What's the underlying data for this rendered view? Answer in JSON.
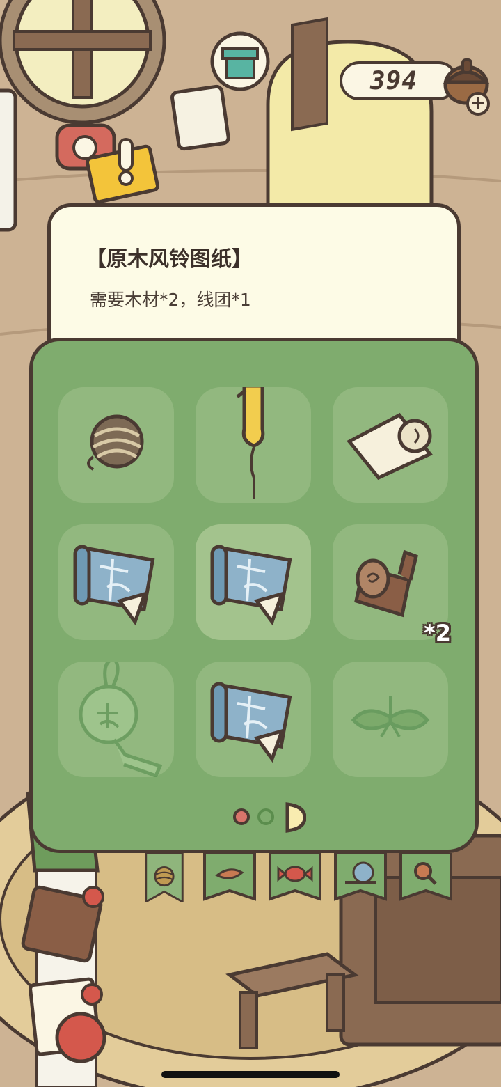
{
  "header": {
    "currency_value": "394",
    "currency_icon": "acorn-icon",
    "add_label": "+"
  },
  "tooltip": {
    "title": "【原木风铃图纸】",
    "description": "需要木材*2，线团*1"
  },
  "grid": {
    "items": [
      {
        "name": "yarn-ball",
        "icon": "yarn-ball-icon",
        "selected": false
      },
      {
        "name": "balloon",
        "icon": "balloon-icon",
        "selected": false
      },
      {
        "name": "paper-scroll",
        "icon": "paper-scroll-icon",
        "selected": false
      },
      {
        "name": "blueprint",
        "icon": "blueprint-icon",
        "selected": false
      },
      {
        "name": "blueprint",
        "icon": "blueprint-icon",
        "selected": true
      },
      {
        "name": "wood-log",
        "icon": "wood-log-icon",
        "count": "*2",
        "selected": false
      },
      {
        "name": "wind-chime",
        "icon": "wind-chime-icon",
        "selected": false
      },
      {
        "name": "blueprint",
        "icon": "blueprint-icon",
        "selected": false
      },
      {
        "name": "clover",
        "icon": "clover-icon",
        "selected": false
      }
    ]
  },
  "pager": {
    "pages": 3,
    "current": 1
  },
  "tabs": [
    {
      "name": "yarn",
      "icon": "yarn-ball-icon",
      "active": true
    },
    {
      "name": "leaf",
      "icon": "leaf-icon",
      "active": false
    },
    {
      "name": "candy",
      "icon": "candy-icon",
      "active": false
    },
    {
      "name": "snail",
      "icon": "snail-icon",
      "active": false
    },
    {
      "name": "magnifier",
      "icon": "magnifier-icon",
      "active": false
    }
  ],
  "colors": {
    "panel": "#7fac6e",
    "slot": "#92b87f",
    "outline": "#4a3a32",
    "tooltip_bg": "#fdfbe6"
  }
}
